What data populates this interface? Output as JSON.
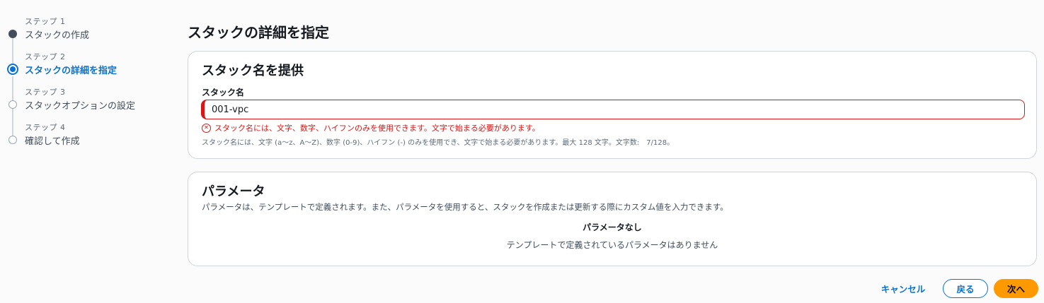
{
  "wizard": {
    "steps": [
      {
        "caption": "ステップ 1",
        "title": "スタックの作成",
        "state": "done"
      },
      {
        "caption": "ステップ 2",
        "title": "スタックの詳細を指定",
        "state": "active"
      },
      {
        "caption": "ステップ 3",
        "title": "スタックオプションの設定",
        "state": "pending"
      },
      {
        "caption": "ステップ 4",
        "title": "確認して作成",
        "state": "pending"
      }
    ]
  },
  "page": {
    "title": "スタックの詳細を指定"
  },
  "stack_name_section": {
    "header": "スタック名を提供",
    "label": "スタック名",
    "value": "001-vpc",
    "error": "スタック名には、文字、数字、ハイフンのみを使用できます。文字で始まる必要があります。",
    "constraint": "スタック名には、文字 (a〜z、A〜Z)、数字 (0-9)、ハイフン (-) のみを使用でき、文字で始まる必要があります。最大 128 文字。文字数:　7/128。"
  },
  "parameters_section": {
    "header": "パラメータ",
    "description": "パラメータは、テンプレートで定義されます。また、パラメータを使用すると、スタックを作成または更新する際にカスタム値を入力できます。",
    "empty_title": "パラメータなし",
    "empty_description": "テンプレートで定義されているパラメータはありません"
  },
  "actions": {
    "cancel": "キャンセル",
    "back": "戻る",
    "next": "次へ"
  },
  "colors": {
    "primary": "#0972d3",
    "error": "#d91515",
    "accent": "#ff9900"
  }
}
